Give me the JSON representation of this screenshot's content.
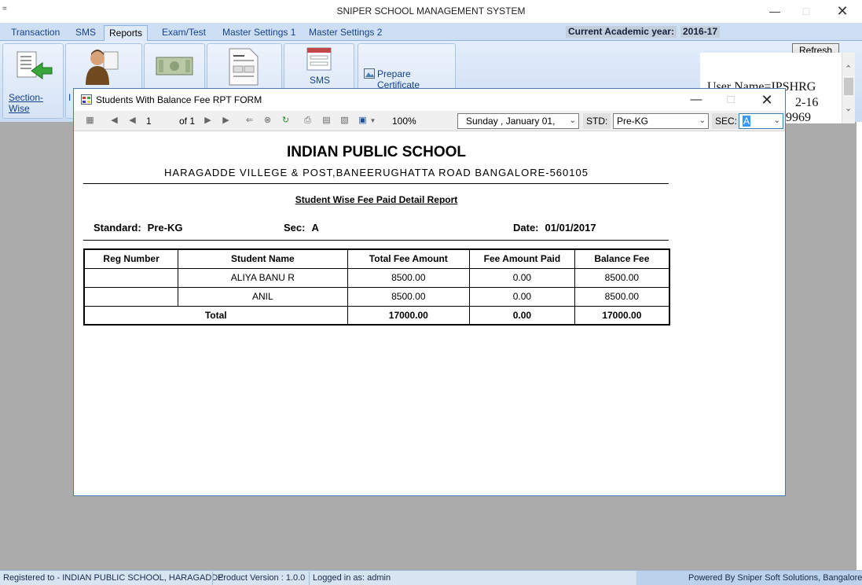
{
  "app": {
    "title": "SNIPER SCHOOL MANAGEMENT SYSTEM",
    "quick_access": "="
  },
  "ribbon": {
    "tabs": [
      "Transaction",
      "SMS",
      "Reports",
      "Exam/Test",
      "Master Settings 1",
      "Master Settings 2"
    ],
    "active_tab": "Reports",
    "academic_year_label": "Current Academic year:",
    "academic_year_value": "2016-17",
    "buttons": {
      "section_wise": "Section-Wise",
      "individual": "I",
      "sms": "SMS",
      "prepare_certificate": "Prepare Certificate"
    },
    "refresh": "Refresh",
    "user_lines": [
      "User Name=IPSHRG",
      "2-16",
      "9969"
    ]
  },
  "child": {
    "title": "Students With Balance Fee RPT FORM",
    "toolbar": {
      "page": "1",
      "of_label": "of 1",
      "zoom": "100%",
      "date": "Sunday  ,  January  01,",
      "std_label": "STD:",
      "std_value": "Pre-KG",
      "sec_label": "SEC:",
      "sec_value": "A"
    },
    "report": {
      "school": "INDIAN PUBLIC SCHOOL",
      "address": "HARAGADDE VILLEGE & POST,BANEERUGHATTA ROAD BANGALORE-560105",
      "report_title": "Student Wise Fee Paid Detail Report",
      "standard_label": "Standard:",
      "standard_value": "Pre-KG",
      "sec_label": "Sec:",
      "sec_value": "A",
      "date_label": "Date:",
      "date_value": "01/01/2017",
      "columns": [
        "Reg Number",
        "Student Name",
        "Total Fee Amount",
        "Fee Amount Paid",
        "Balance Fee"
      ],
      "rows": [
        [
          "",
          "ALIYA BANU R",
          "8500.00",
          "0.00",
          "8500.00"
        ],
        [
          "",
          "ANIL",
          "8500.00",
          "0.00",
          "8500.00"
        ]
      ],
      "total": [
        "Total",
        "17000.00",
        "0.00",
        "17000.00"
      ]
    }
  },
  "statusbar": {
    "registered": "Registered to - INDIAN PUBLIC SCHOOL, HARAGADDE",
    "version": "Product Version : 1.0.0",
    "logged_in": "Logged in as: admin",
    "powered": "Powered By Sniper Soft Solutions, Bangalore"
  }
}
